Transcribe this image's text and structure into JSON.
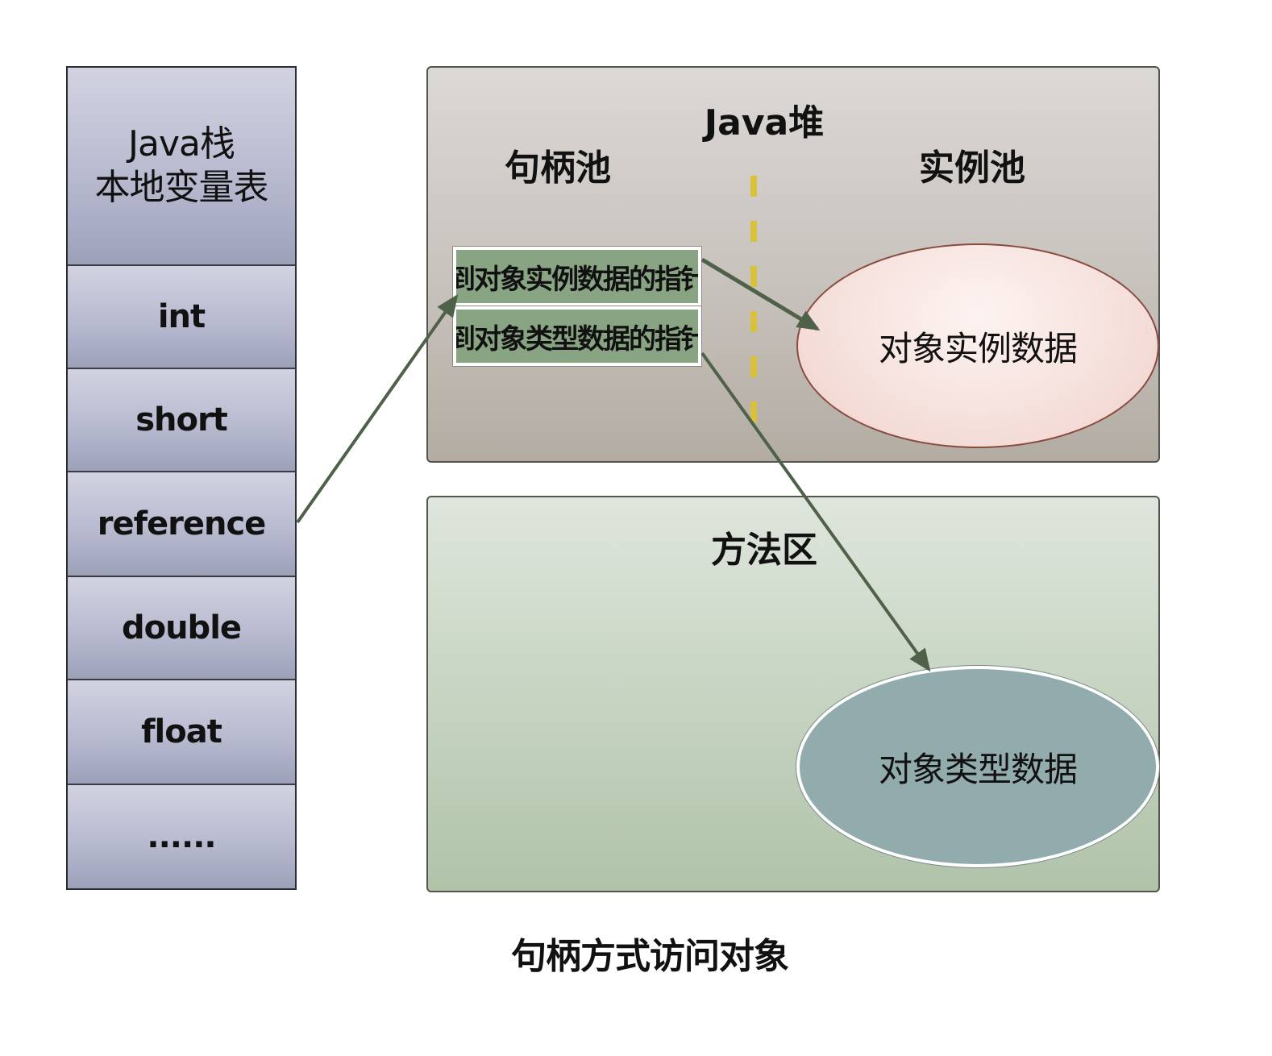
{
  "stack": {
    "header_line1": "Java栈",
    "header_line2": "本地变量表",
    "items": [
      "int",
      "short",
      "reference",
      "double",
      "float",
      "......"
    ]
  },
  "heap": {
    "title": "Java堆",
    "handle_pool_label": "句柄池",
    "instance_pool_label": "实例池",
    "handle_instance_pointer": "到对象实例数据的指针",
    "handle_type_pointer": "到对象类型数据的指针",
    "instance_data": "对象实例数据"
  },
  "method_area": {
    "title": "方法区",
    "type_data": "对象类型数据"
  },
  "caption": "句柄方式访问对象",
  "colors": {
    "arrow": "#4f6148",
    "divider": "#d9c23a",
    "handle_fill": "#88a483",
    "type_data_fill": "#92abac"
  }
}
